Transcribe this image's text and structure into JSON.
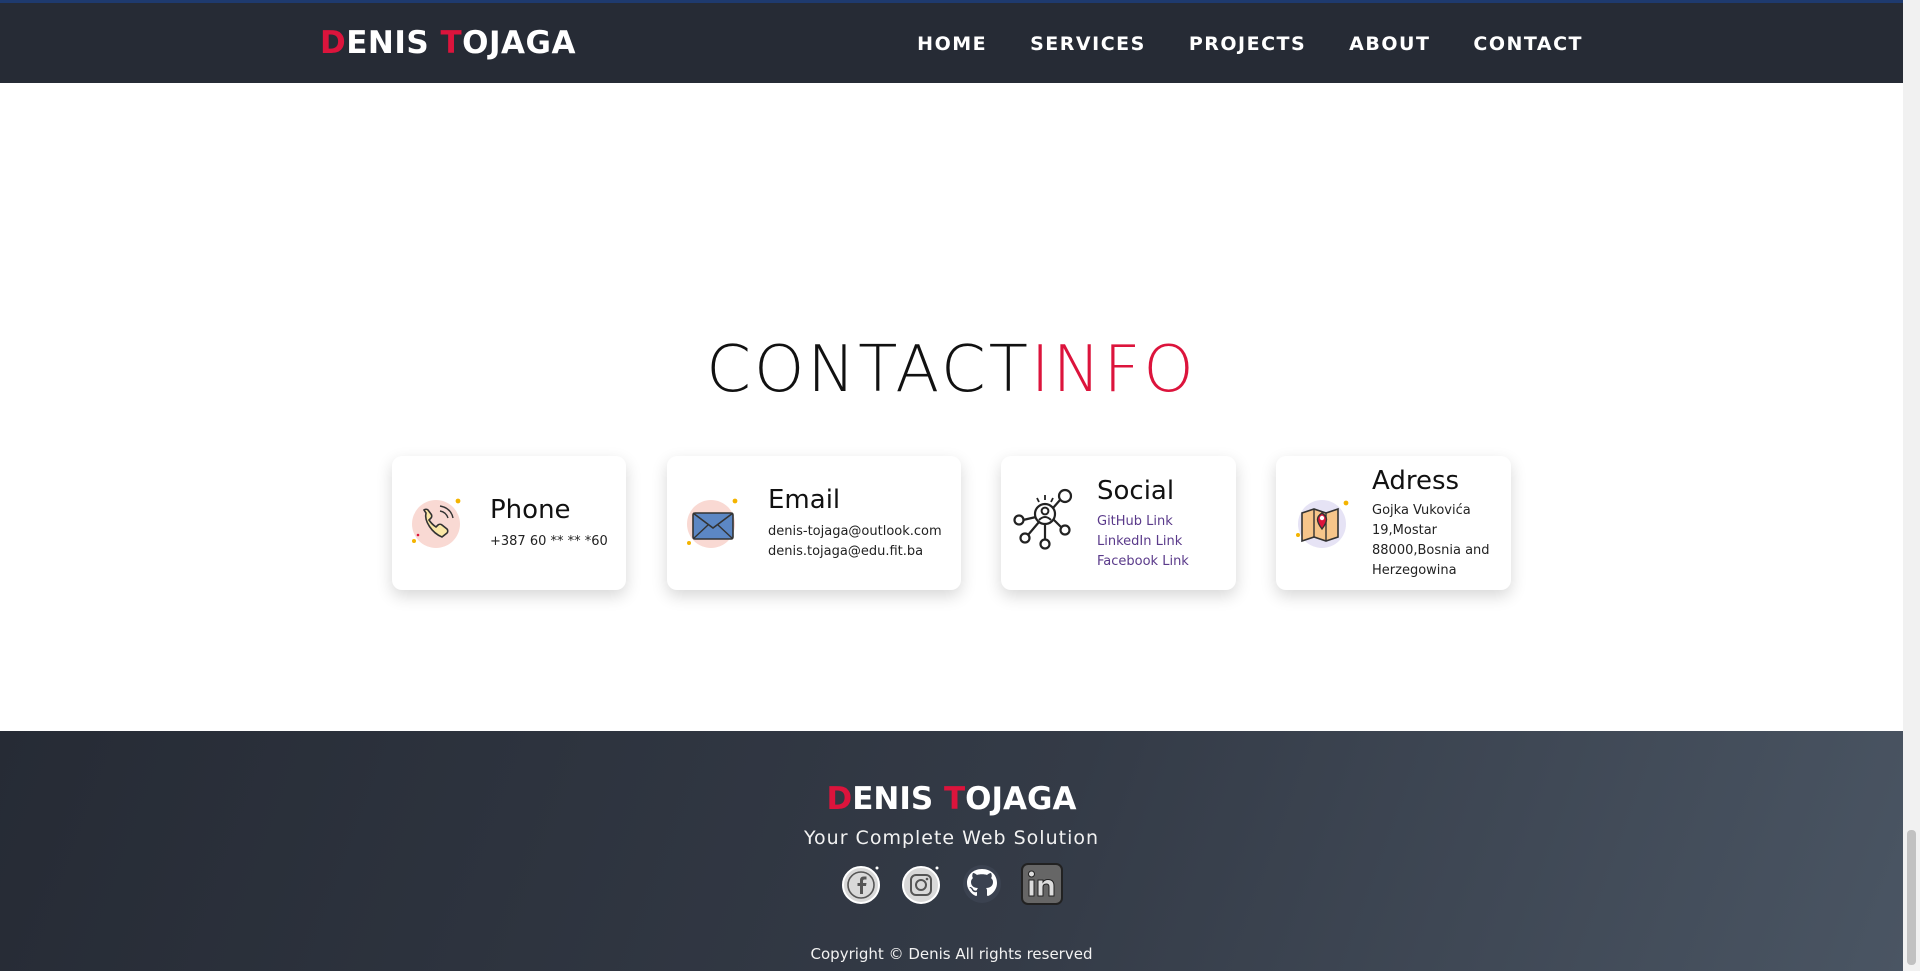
{
  "navbar": {
    "brand_first_initial": "D",
    "brand_first_rest": "ENIS",
    "brand_last_initial": "T",
    "brand_last_rest": "OJAGA",
    "links": [
      "HOME",
      "SERVICES",
      "PROJECTS",
      "ABOUT",
      "CONTACT"
    ]
  },
  "contact": {
    "title_main": "CONTACT",
    "title_accent": "INFO",
    "phone": {
      "icon": "phone-icon",
      "title": "Phone",
      "value": "+387 60 ** ** *60"
    },
    "email": {
      "icon": "envelope-icon",
      "title": "Email",
      "lines": [
        "denis-tojaga@outlook.com",
        "denis.tojaga@edu.fit.ba"
      ]
    },
    "social": {
      "icon": "network-icon",
      "title": "Social",
      "links": [
        "GitHub Link",
        "LinkedIn Link",
        "Facebook Link"
      ]
    },
    "address": {
      "icon": "map-pin-icon",
      "title": "Adress",
      "lines": [
        "Gojka Vukovića",
        "19,Mostar",
        "88000,Bosnia and",
        "Herzegowina"
      ]
    }
  },
  "footer": {
    "brand_first_initial": "D",
    "brand_first_rest": "ENIS",
    "brand_last_initial": "T",
    "brand_last_rest": "OJAGA",
    "tagline": "Your Complete Web Solution",
    "social_icons": [
      "facebook-icon",
      "instagram-icon",
      "github-icon",
      "linkedin-icon"
    ],
    "copyright": "Copyright © Denis All rights reserved"
  },
  "colors": {
    "accent": "#dc143c",
    "navbar_bg": "#262b35",
    "link": "#5a3a8a"
  }
}
